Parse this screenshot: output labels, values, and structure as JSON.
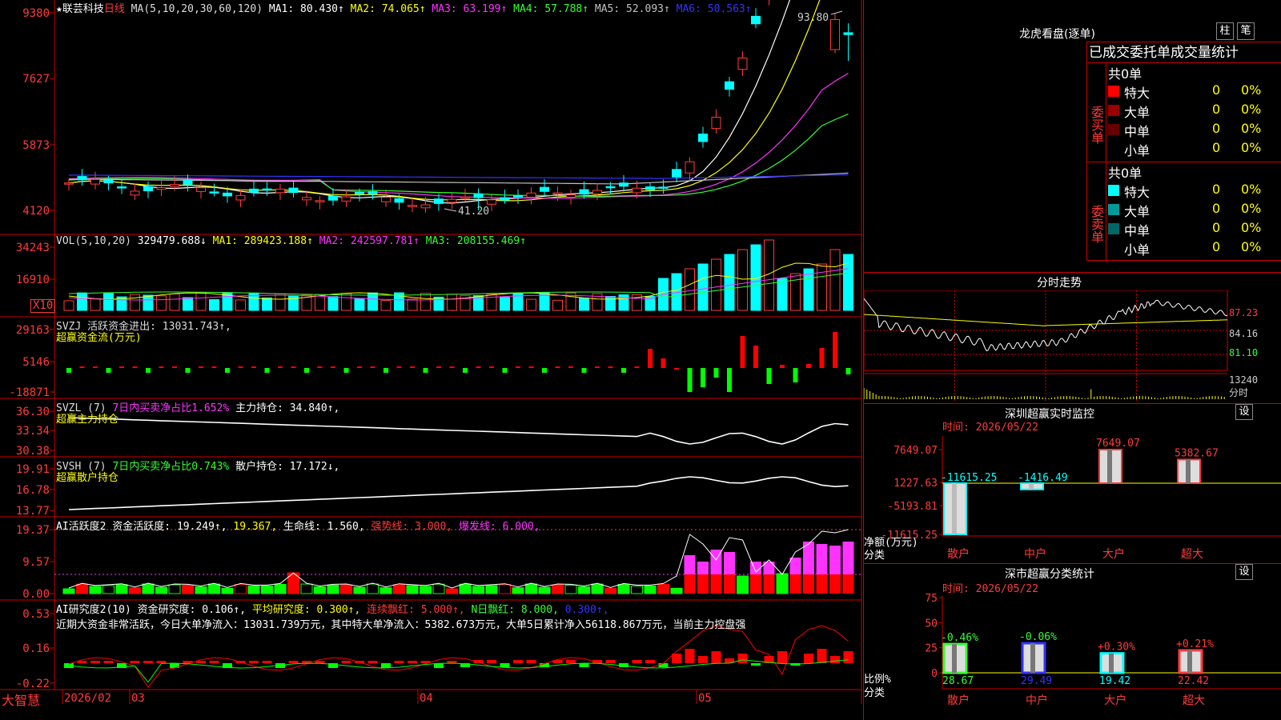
{
  "main": {
    "title": "★联芸科技",
    "period": "日线",
    "ma_header": {
      "label": "MA(5,10,20,30,60,120)",
      "items": [
        {
          "text": "MA1: 80.430↑",
          "color": "#ffffff"
        },
        {
          "text": "MA2: 74.065↑",
          "color": "#ffff00"
        },
        {
          "text": "MA3: 63.199↑",
          "color": "#ff33ff"
        },
        {
          "text": "MA4: 57.788↑",
          "color": "#33ff33"
        },
        {
          "text": "MA5: 52.093↑",
          "color": "#c0c0c0"
        },
        {
          "text": "MA6: 50.563↑",
          "color": "#3333ff"
        }
      ]
    },
    "yticks": [
      "9380",
      "7627",
      "5873",
      "4120"
    ],
    "high_label": "93.80",
    "low_label": "41.20",
    "watermark": "大智慧",
    "dates": [
      "2026/02",
      "03",
      "04",
      "05"
    ]
  },
  "vol": {
    "header": [
      {
        "text": "VOL(5,10,20)",
        "color": "#dddddd"
      },
      {
        "text": "329479.688↓",
        "color": "#ffffff"
      },
      {
        "text": "MA1: 289423.188↑",
        "color": "#ffff00"
      },
      {
        "text": "MA2: 242597.781↑",
        "color": "#ff33ff"
      },
      {
        "text": "MA3: 208155.469↑",
        "color": "#33ff33"
      }
    ],
    "yticks": [
      "34243",
      "16910"
    ],
    "unit": "X10"
  },
  "svzj": {
    "header": [
      {
        "text": "SVZJ  活跃资金进出: 13031.743↑,",
        "color": "#dddddd"
      }
    ],
    "subtitle": "超赢资金流(万元)",
    "yticks": [
      "29163",
      "5146",
      "-18871"
    ]
  },
  "svzl": {
    "header": [
      {
        "text": "SVZL (7)",
        "color": "#dddddd"
      },
      {
        "text": "7日内买卖净占比1.652%",
        "color": "#ff33ff"
      },
      {
        "text": "主力持仓: 34.840↑,",
        "color": "#ffffff"
      }
    ],
    "subtitle": "超赢主力持仓",
    "yticks": [
      "36.30",
      "33.34",
      "30.38"
    ]
  },
  "svsh": {
    "header": [
      {
        "text": "SVSH (7)",
        "color": "#dddddd"
      },
      {
        "text": "7日内买卖净占比0.743%",
        "color": "#33ff33"
      },
      {
        "text": "散户持仓: 17.172↓,",
        "color": "#ffffff"
      }
    ],
    "subtitle": "超赢散户持仓",
    "yticks": [
      "19.91",
      "16.78",
      "13.77"
    ]
  },
  "ai_hyd": {
    "header": [
      {
        "text": "AI活跃度2 资金活跃度: 19.249↑,",
        "color": "#ffffff"
      },
      {
        "text": "19.367,",
        "color": "#ffff00"
      },
      {
        "text": "生命线: 1.560,",
        "color": "#ffffff"
      },
      {
        "text": "强势线: 3.000,",
        "color": "#ff3b3b"
      },
      {
        "text": "爆发线: 6.000,",
        "color": "#ff33ff"
      }
    ],
    "yticks": [
      "19.37",
      "9.57",
      "0.00"
    ]
  },
  "ai_yjd": {
    "header": [
      {
        "text": "AI研究度2(10) 资金研究度: 0.106↑,",
        "color": "#ffffff"
      },
      {
        "text": "平均研究度: 0.300↑,",
        "color": "#ffff00"
      },
      {
        "text": "连续飘红: 5.000↑,",
        "color": "#ff3b3b"
      },
      {
        "text": "N日飘红: 8.000,",
        "color": "#33ff33"
      },
      {
        "text": "0.300↑,",
        "color": "#3333ff"
      }
    ],
    "comment": "近期大资金非常活跃，今日大单净流入：13031.739万元，其中特大单净流入：5382.673万元，大单5日累计净入56118.867万元，当前主力控盘强",
    "yticks": [
      "0.53",
      "0.16",
      "-0.22"
    ]
  },
  "lhkp": {
    "title": "龙虎看盘(逐单)",
    "btn1": "柱",
    "btn2": "笔",
    "subtitle": "已成交委托单成交量统计",
    "buy": {
      "label": "委买单",
      "total": "共0单",
      "rows": [
        {
          "name": "特大",
          "count": "0",
          "pct": "0%",
          "color": "#ff0000"
        },
        {
          "name": "大单",
          "count": "0",
          "pct": "0%",
          "color": "#990000"
        },
        {
          "name": "中单",
          "count": "0",
          "pct": "0%",
          "color": "#660000"
        },
        {
          "name": "小单",
          "count": "0",
          "pct": "0%",
          "color": "#000000"
        }
      ]
    },
    "sell": {
      "label": "委卖单",
      "total": "共0单",
      "rows": [
        {
          "name": "特大",
          "count": "0",
          "pct": "0%",
          "color": "#00ffff"
        },
        {
          "name": "大单",
          "count": "0",
          "pct": "0%",
          "color": "#009999"
        },
        {
          "name": "中单",
          "count": "0",
          "pct": "0%",
          "color": "#006666"
        },
        {
          "name": "小单",
          "count": "0",
          "pct": "0%",
          "color": "#000000"
        }
      ]
    }
  },
  "fszs": {
    "title": "分时走势",
    "yticks": [
      "87.23",
      "84.16",
      "81.10"
    ],
    "vol_label": "13240",
    "fs_label": "分时"
  },
  "szjk": {
    "title": "深圳超赢实时监控",
    "btn": "设",
    "time": "时间: 2026/05/22",
    "yticks": [
      "7649.07",
      "1227.63",
      "-5193.81",
      "-11615.25"
    ],
    "axis_label1": "净额(万元)",
    "axis_label2": "分类",
    "bars": [
      {
        "cat": "散户",
        "value": -11615.25,
        "label": "-11615.25",
        "color": "#00ffff"
      },
      {
        "cat": "中户",
        "value": -1416.49,
        "label": "-1416.49",
        "color": "#00ffff"
      },
      {
        "cat": "大户",
        "value": 7649.07,
        "label": "7649.07",
        "color": "#ff3b3b"
      },
      {
        "cat": "超大",
        "value": 5382.67,
        "label": "5382.67",
        "color": "#ff3b3b"
      }
    ]
  },
  "scfl": {
    "title": "深市超赢分类统计",
    "btn": "设",
    "time": "时间: 2026/05/22",
    "yticks": [
      "75",
      "50",
      "25",
      "0"
    ],
    "axis_label1": "比例%",
    "axis_label2": "分类",
    "bars": [
      {
        "cat": "散户",
        "value": 28.67,
        "label": "28.67",
        "chg": "-0.46%",
        "color": "#33ff33",
        "chgcolor": "#33ff33"
      },
      {
        "cat": "中户",
        "value": 29.49,
        "label": "29.49",
        "chg": "-0.06%",
        "color": "#3333ff",
        "chgcolor": "#33ff33"
      },
      {
        "cat": "大户",
        "value": 19.42,
        "label": "19.42",
        "chg": "+0.30%",
        "color": "#00ffff",
        "chgcolor": "#ff3b3b"
      },
      {
        "cat": "超大",
        "value": 22.42,
        "label": "22.42",
        "chg": "+0.21%",
        "color": "#ff3b3b",
        "chgcolor": "#ff3b3b"
      }
    ]
  },
  "chart_data": [
    {
      "type": "candlestick",
      "title": "★联芸科技 日线",
      "ylim": [
        41.2,
        93.8
      ],
      "ma_values": {
        "MA1": 80.43,
        "MA2": 74.065,
        "MA3": 63.199,
        "MA4": 57.788,
        "MA5": 52.093,
        "MA6": 50.563
      },
      "high": 93.8,
      "low": 41.2
    },
    {
      "type": "bar",
      "title": "VOL(5,10,20)",
      "last": 329479.688,
      "ma": {
        "MA1": 289423.188,
        "MA2": 242597.781,
        "MA3": 208155.469
      }
    },
    {
      "type": "bar",
      "title": "深圳超赢实时监控",
      "ylabel": "净额(万元)",
      "categories": [
        "散户",
        "中户",
        "大户",
        "超大"
      ],
      "values": [
        -11615.25,
        -1416.49,
        7649.07,
        5382.67
      ]
    },
    {
      "type": "bar",
      "title": "深市超赢分类统计",
      "ylabel": "比例%",
      "categories": [
        "散户",
        "中户",
        "大户",
        "超大"
      ],
      "values": [
        28.67,
        29.49,
        19.42,
        22.42
      ],
      "changes": [
        "-0.46%",
        "-0.06%",
        "+0.30%",
        "+0.21%"
      ],
      "ylim": [
        0,
        75
      ]
    }
  ]
}
